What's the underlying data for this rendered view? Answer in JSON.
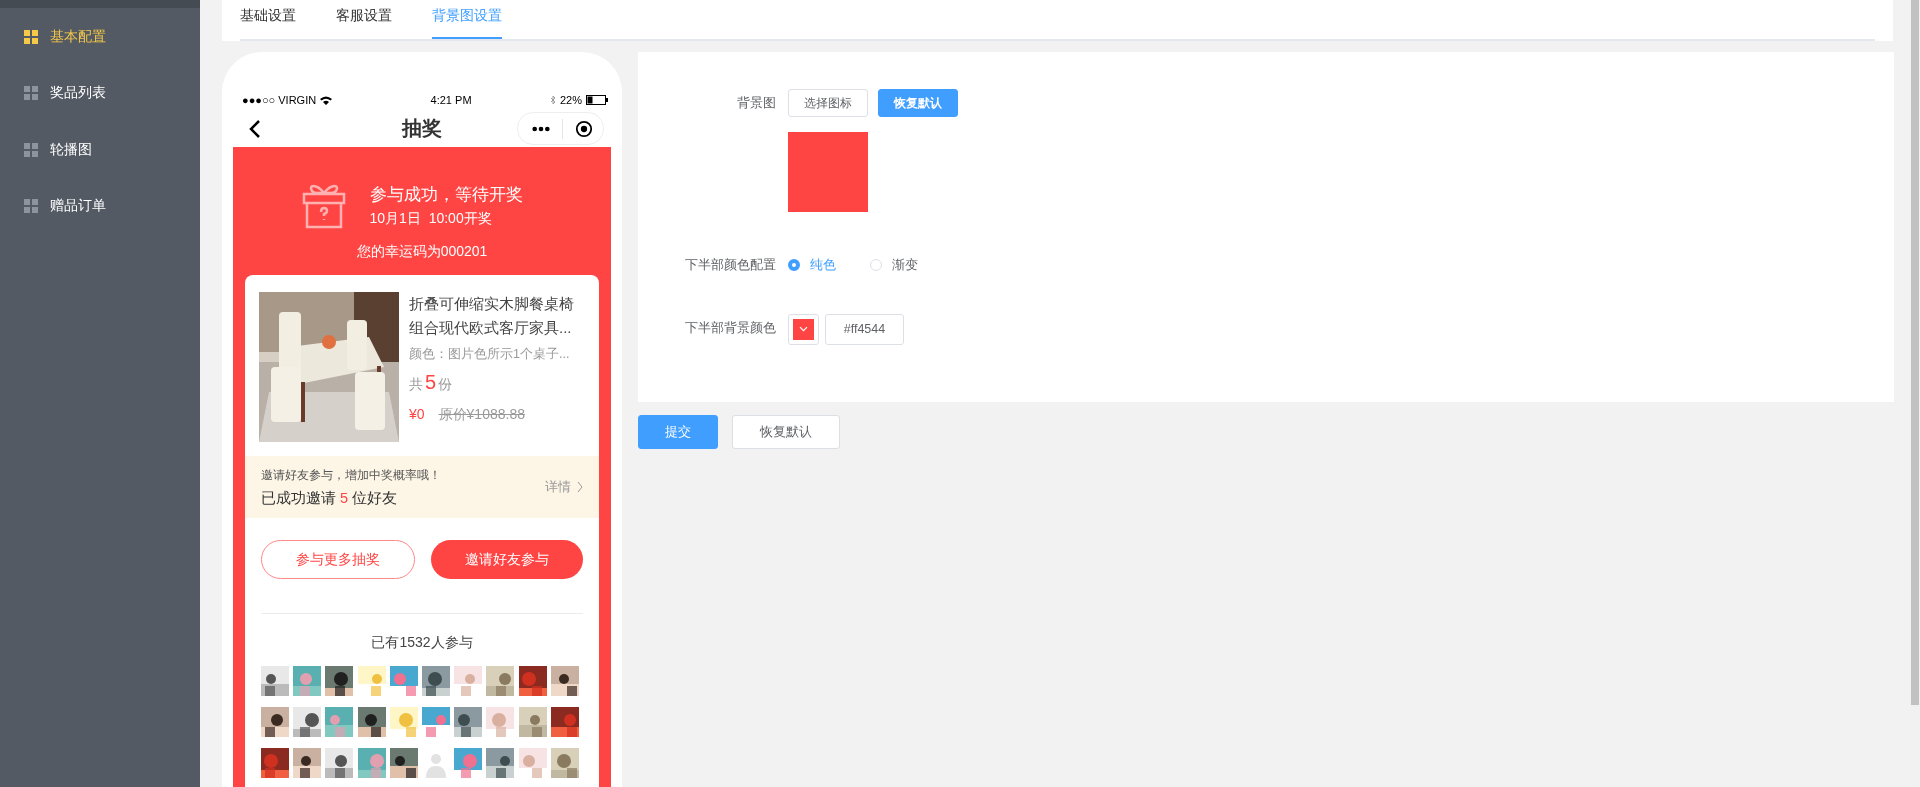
{
  "sidebar": {
    "items": [
      {
        "label": "基本配置",
        "selected": true
      },
      {
        "label": "奖品列表",
        "selected": false
      },
      {
        "label": "轮播图",
        "selected": false
      },
      {
        "label": "赠品订单",
        "selected": false
      }
    ]
  },
  "tabs": [
    {
      "label": "基础设置",
      "selected": false
    },
    {
      "label": "客服设置",
      "selected": false
    },
    {
      "label": "背景图设置",
      "selected": true
    }
  ],
  "phone": {
    "status_bar": {
      "carrier": "●●●○○ VIRGIN",
      "time": "4:21 PM",
      "battery": "22%"
    },
    "nav_title": "抽奖",
    "header": {
      "title": "参与成功，等待开奖",
      "subtitle": "10月1日  10:00开奖",
      "lucky_code": "您的幸运码为000201"
    },
    "product": {
      "title": "折叠可伸缩实木脚餐桌椅组合现代欧式客厅家具...",
      "spec": "颜色：图片色所示1个桌子...",
      "count_prefix": "共",
      "count": "5",
      "count_suffix": "份",
      "price": "¥0",
      "original_price": "原价¥1088.88"
    },
    "invite": {
      "hint": "邀请好友参与，增加中奖概率哦！",
      "invited_prefix": "已成功邀请",
      "invited_count": "5",
      "invited_suffix": "位好友",
      "detail": "详情"
    },
    "buttons": [
      {
        "label": "参与更多抽奖",
        "kind": "outline"
      },
      {
        "label": "邀请好友参与",
        "kind": "filled"
      }
    ],
    "participants": "已有1532人参与",
    "avatars": [
      {
        "kind": "picture"
      },
      {
        "kind": "picture"
      },
      {
        "kind": "picture"
      },
      {
        "kind": "picture"
      },
      {
        "kind": "picture"
      },
      {
        "kind": "picture"
      },
      {
        "kind": "picture"
      },
      {
        "kind": "picture"
      },
      {
        "kind": "picture"
      },
      {
        "kind": "picture"
      },
      {
        "kind": "picture"
      },
      {
        "kind": "picture"
      },
      {
        "kind": "picture"
      },
      {
        "kind": "picture"
      },
      {
        "kind": "picture"
      },
      {
        "kind": "picture"
      },
      {
        "kind": "picture"
      },
      {
        "kind": "picture"
      },
      {
        "kind": "picture"
      },
      {
        "kind": "picture"
      },
      {
        "kind": "picture"
      },
      {
        "kind": "picture"
      },
      {
        "kind": "picture"
      },
      {
        "kind": "picture"
      },
      {
        "kind": "picture"
      },
      {
        "kind": "placeholder"
      },
      {
        "kind": "picture"
      },
      {
        "kind": "picture"
      },
      {
        "kind": "picture"
      },
      {
        "kind": "picture"
      }
    ]
  },
  "form": {
    "background_label": "背景图",
    "choose_button": "选择图标",
    "reset_button": "恢复默认",
    "color_mode_label": "下半部颜色配置",
    "color_modes": [
      {
        "label": "纯色",
        "selected": true
      },
      {
        "label": "渐变",
        "selected": false
      }
    ],
    "bottom_color_label": "下半部背景颜色",
    "bottom_color_value": "#ff4544"
  },
  "actions": [
    {
      "label": "提交",
      "kind": "primary"
    },
    {
      "label": "恢复默认",
      "kind": "default"
    }
  ]
}
